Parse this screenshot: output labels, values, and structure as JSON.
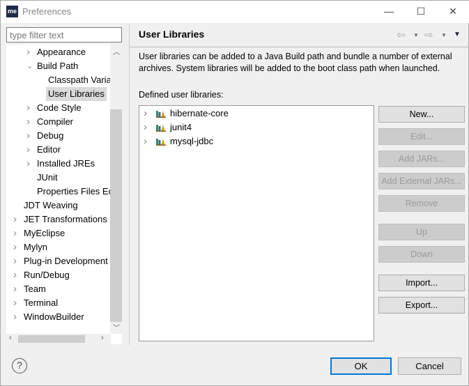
{
  "window": {
    "title": "Preferences",
    "logo": "me",
    "minimize": "—",
    "maximize": "☐",
    "close": "✕"
  },
  "filter": {
    "placeholder": "type filter text"
  },
  "tree": [
    {
      "label": "Appearance",
      "level": 1,
      "state": "collapsed"
    },
    {
      "label": "Build Path",
      "level": 1,
      "state": "expanded"
    },
    {
      "label": "Classpath Varia",
      "level": 2,
      "state": "leaf"
    },
    {
      "label": "User Libraries",
      "level": 2,
      "state": "leaf",
      "selected": true
    },
    {
      "label": "Code Style",
      "level": 1,
      "state": "collapsed"
    },
    {
      "label": "Compiler",
      "level": 1,
      "state": "collapsed"
    },
    {
      "label": "Debug",
      "level": 1,
      "state": "collapsed"
    },
    {
      "label": "Editor",
      "level": 1,
      "state": "collapsed"
    },
    {
      "label": "Installed JREs",
      "level": 1,
      "state": "collapsed"
    },
    {
      "label": "JUnit",
      "level": 1,
      "state": "leaf"
    },
    {
      "label": "Properties Files Ed",
      "level": 1,
      "state": "leaf"
    },
    {
      "label": "JDT Weaving",
      "level": 0,
      "state": "leaf"
    },
    {
      "label": "JET Transformations",
      "level": 0,
      "state": "collapsed"
    },
    {
      "label": "MyEclipse",
      "level": 0,
      "state": "collapsed"
    },
    {
      "label": "Mylyn",
      "level": 0,
      "state": "collapsed"
    },
    {
      "label": "Plug-in Development",
      "level": 0,
      "state": "collapsed"
    },
    {
      "label": "Run/Debug",
      "level": 0,
      "state": "collapsed"
    },
    {
      "label": "Team",
      "level": 0,
      "state": "collapsed"
    },
    {
      "label": "Terminal",
      "level": 0,
      "state": "collapsed"
    },
    {
      "label": "WindowBuilder",
      "level": 0,
      "state": "collapsed"
    }
  ],
  "page": {
    "title": "User Libraries",
    "description": "User libraries can be added to a Java Build path and bundle a number of external archives. System libraries will be added to the boot class path when launched.",
    "list_label": "Defined user libraries:",
    "libraries": [
      "hibernate-core",
      "junit4",
      "mysql-jdbc"
    ],
    "buttons": [
      {
        "label": "New...",
        "enabled": true
      },
      {
        "label": "Edit...",
        "enabled": false
      },
      {
        "label": "Add JARs...",
        "enabled": false
      },
      {
        "label": "Add External JARs...",
        "enabled": false
      },
      {
        "label": "Remove",
        "enabled": false
      },
      {
        "label": "Up",
        "enabled": false
      },
      {
        "label": "Down",
        "enabled": false
      },
      {
        "label": "Import...",
        "enabled": true
      },
      {
        "label": "Export...",
        "enabled": true
      }
    ]
  },
  "footer": {
    "help": "?",
    "ok": "OK",
    "cancel": "Cancel"
  }
}
